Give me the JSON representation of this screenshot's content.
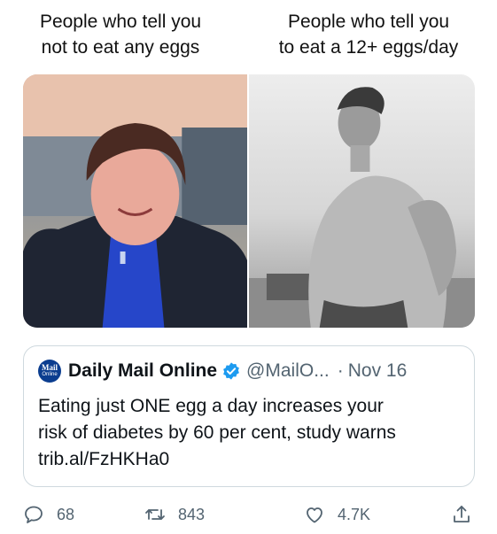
{
  "captions": {
    "left": "People who tell you\nnot to eat any eggs",
    "right": "People who tell you\nto eat a 12+ eggs/day"
  },
  "media": {
    "left_image": "portrait-woman-dark-jacket",
    "right_image": "bodybuilder-black-and-white"
  },
  "quoted_tweet": {
    "logo_line1": "Mail",
    "logo_line2": "Online",
    "display_name": "Daily Mail Online",
    "verified_icon": "verified-badge-icon",
    "handle": "@MailO...",
    "separator": "·",
    "date": "Nov 16",
    "text": "Eating just ONE egg a day increases your\nrisk of diabetes by 60 per cent, study warns\ntrib.al/FzHKHa0"
  },
  "actions": {
    "replies": "68",
    "retweets": "843",
    "likes": "4.7K"
  },
  "colors": {
    "text": "#0f1419",
    "secondary": "#536471",
    "border": "#cfd9de",
    "verified": "#1d9bf0",
    "mail_logo": "#0b3d8f"
  }
}
